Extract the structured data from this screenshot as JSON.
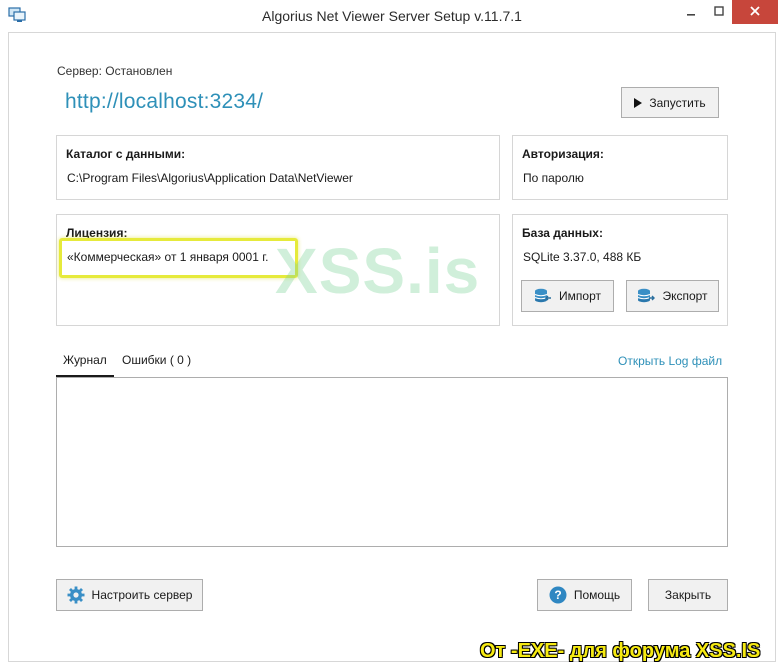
{
  "window": {
    "title": "Algorius Net Viewer Server Setup v.11.7.1",
    "icon": "app-monitor-icon",
    "controls": [
      "minimize-icon",
      "maximize-icon",
      "close-icon"
    ],
    "close_color": "#c7463b"
  },
  "server": {
    "status_text": "Сервер:  Остановлен",
    "url": "http://localhost:3234/",
    "url_color": "#2e90b8",
    "start_button_label": "Запустить"
  },
  "data_catalog": {
    "title": "Каталог с данными:",
    "path": "C:\\Program Files\\Algorius\\Application Data\\NetViewer"
  },
  "authorization": {
    "title": "Авторизация:",
    "value": "По паролю"
  },
  "license": {
    "title": "Лицензия:",
    "value": "«Коммерческая» от 1 января 0001 г.",
    "highlight_color": "#e6ea3b"
  },
  "database": {
    "title": "База данных:",
    "value": "SQLite 3.37.0,  488 КБ",
    "import_label": "Импорт",
    "export_label": "Экспорт"
  },
  "tabs": [
    {
      "label": "Журнал",
      "active": true
    },
    {
      "label": "Ошибки ( 0 )",
      "active": false
    }
  ],
  "open_log_label": "Открыть Log файл",
  "footer": {
    "configure_label": "Настроить сервер",
    "help_label": "Помощь",
    "close_label": "Закрыть"
  },
  "overlay": {
    "watermark": "XSS.is",
    "caption": "От -EXE- для форума XSS.IS",
    "caption_color": "#f6ea12"
  }
}
